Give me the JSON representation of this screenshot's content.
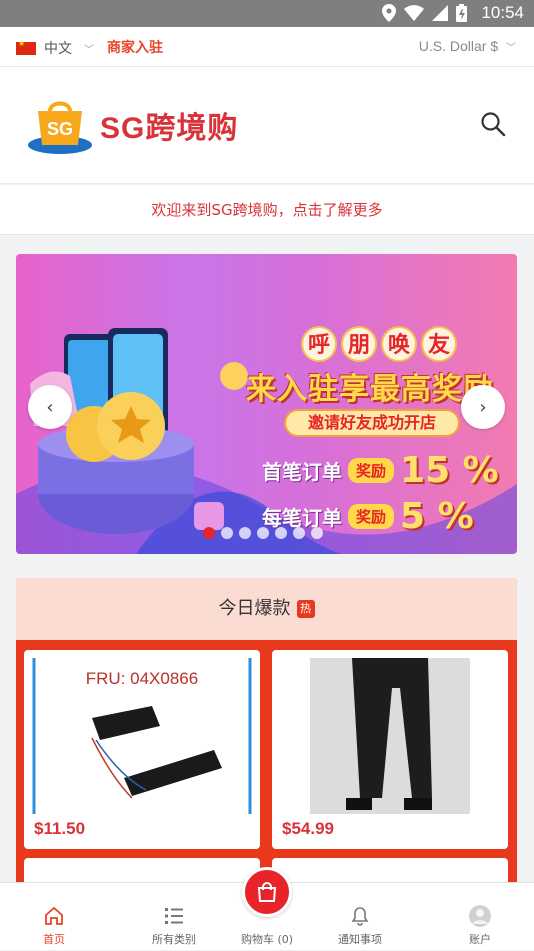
{
  "status_bar": {
    "time": "10:54"
  },
  "topbar": {
    "language": "中文",
    "merchant_link": "商家入驻",
    "currency": "U.S. Dollar $"
  },
  "header": {
    "logo_badge": "SG",
    "logo_text": "SG跨境购"
  },
  "welcome": {
    "text": "欢迎来到SG跨境购，点击了解更多"
  },
  "banner": {
    "title_chars": [
      "呼",
      "朋",
      "唤",
      "友"
    ],
    "headline": "来入驻享最高奖励",
    "pill": "邀请好友成功开店",
    "row1": {
      "label": "首笔订单",
      "tag": "奖励",
      "pct": "15 %"
    },
    "row2": {
      "label": "每笔订单",
      "tag": "奖励",
      "pct": "5 %"
    },
    "slide_count": 7,
    "active_slide": 0
  },
  "hot_section": {
    "title": "今日爆款",
    "badge": "热",
    "products": [
      {
        "image_caption": "FRU: 04X0866",
        "price": "$11.50"
      },
      {
        "image_caption": "",
        "price": "$54.99"
      }
    ]
  },
  "bottom_nav": {
    "items": [
      {
        "label": "首页",
        "active": true
      },
      {
        "label": "所有类别",
        "active": false
      },
      {
        "label": "购物车 (0)",
        "active": false
      },
      {
        "label": "通知事项",
        "active": false
      },
      {
        "label": "账户",
        "active": false
      }
    ]
  },
  "colors": {
    "brand_red": "#d9333a",
    "accent_orange": "#e8391c",
    "hot_header_bg": "#fbdcd3"
  }
}
